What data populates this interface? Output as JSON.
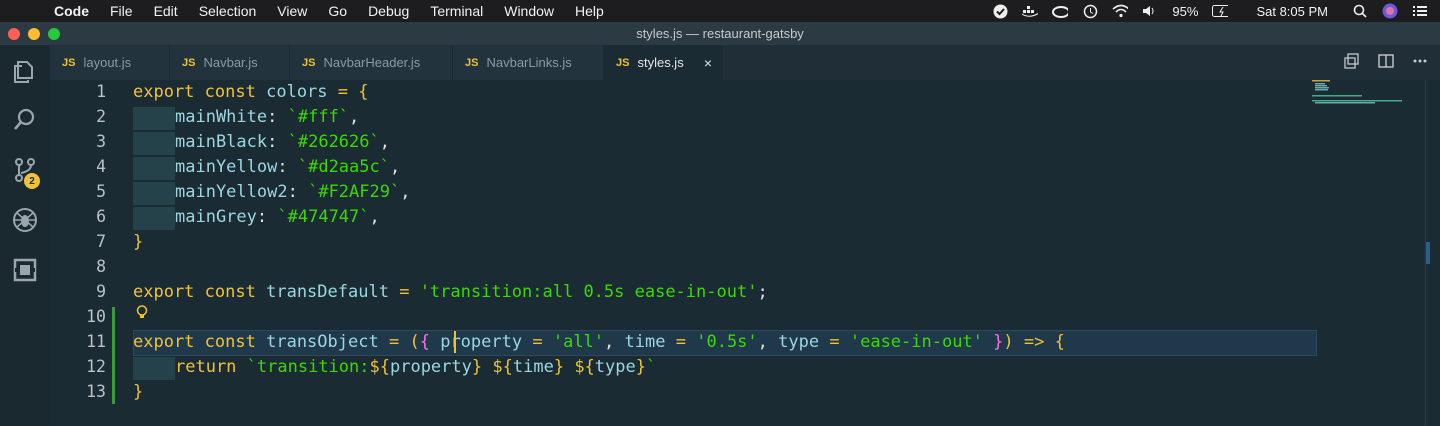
{
  "menubar": {
    "apple": "",
    "items": [
      "Code",
      "File",
      "Edit",
      "Selection",
      "View",
      "Go",
      "Debug",
      "Terminal",
      "Window",
      "Help"
    ],
    "battery": "95%",
    "clock": "Sat 8:05 PM"
  },
  "window": {
    "title": "styles.js — restaurant-gatsby"
  },
  "activity": {
    "scm_badge": "2"
  },
  "tabs": [
    {
      "badge": "JS",
      "label": "layout.js"
    },
    {
      "badge": "JS",
      "label": "Navbar.js"
    },
    {
      "badge": "JS",
      "label": "NavbarHeader.js"
    },
    {
      "badge": "JS",
      "label": "NavbarLinks.js"
    },
    {
      "badge": "JS",
      "label": "styles.js",
      "close": "×"
    }
  ],
  "editor": {
    "line_numbers": [
      "1",
      "2",
      "3",
      "4",
      "5",
      "6",
      "7",
      "8",
      "9",
      "10",
      "11",
      "12",
      "13"
    ]
  },
  "colors": {
    "accent": "#f1c232",
    "string": "#3ad900",
    "variable": "#9ad7e0",
    "background": "#1b2b34"
  }
}
